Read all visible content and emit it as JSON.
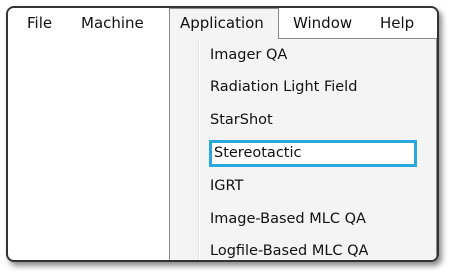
{
  "menubar": {
    "items": [
      {
        "label": "File"
      },
      {
        "label": "Machine"
      },
      {
        "label": "Application"
      },
      {
        "label": "Window"
      },
      {
        "label": "Help"
      }
    ],
    "open_menu": "Application"
  },
  "dropdown": {
    "items": [
      {
        "label": "Imager QA"
      },
      {
        "label": "Radiation Light Field"
      },
      {
        "label": "StarShot"
      },
      {
        "label": "Stereotactic"
      },
      {
        "label": "IGRT"
      },
      {
        "label": "Image-Based MLC QA"
      },
      {
        "label": "Logfile-Based MLC QA"
      }
    ],
    "highlighted_item": "Stereotactic"
  },
  "colors": {
    "highlight_border": "#2aa7dd",
    "window_border": "#333333",
    "menu_background": "#f4f4f4"
  }
}
